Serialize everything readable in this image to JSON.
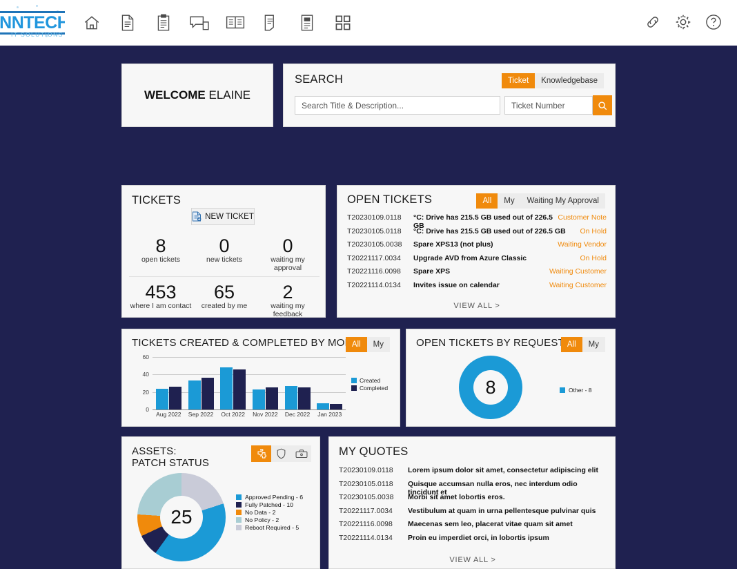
{
  "brand": {
    "logo_main": "ENNTECH",
    "logo_sub": "IT SOLUTIONS",
    "accent_orange": "#f08a0c",
    "accent_blue": "#1b9ad6",
    "navy": "#1f2150"
  },
  "topnav": {
    "items": [
      {
        "icon": "home-icon",
        "name": "home"
      },
      {
        "icon": "document-icon",
        "name": "documents"
      },
      {
        "icon": "clipboard-icon",
        "name": "tickets"
      },
      {
        "icon": "devices-icon",
        "name": "assets"
      },
      {
        "icon": "book-icon",
        "name": "knowledgebase"
      },
      {
        "icon": "pages-icon",
        "name": "quotes"
      },
      {
        "icon": "invoice-icon",
        "name": "invoices"
      },
      {
        "icon": "grid-icon",
        "name": "apps"
      }
    ],
    "right_items": [
      {
        "icon": "link-icon",
        "name": "links"
      },
      {
        "icon": "gear-icon",
        "name": "settings"
      },
      {
        "icon": "help-icon",
        "name": "help"
      }
    ]
  },
  "welcome": {
    "prefix": "WELCOME",
    "name": "ELAINE"
  },
  "search": {
    "title": "SEARCH",
    "tabs": [
      {
        "label": "Ticket",
        "active": true
      },
      {
        "label": "Knowledgebase",
        "active": false
      }
    ],
    "title_placeholder": "Search Title & Description...",
    "title_value": "",
    "number_placeholder": "Ticket Number",
    "number_value": "",
    "search_icon": "search-icon"
  },
  "tickets": {
    "title": "TICKETS",
    "new_ticket_label": "NEW TICKET",
    "new_ticket_icon": "new-document-icon",
    "stats_top": [
      {
        "num": "8",
        "label": "open tickets"
      },
      {
        "num": "0",
        "label": "new tickets"
      },
      {
        "num": "0",
        "label": "waiting my approval"
      }
    ],
    "stats_bottom": [
      {
        "num": "453",
        "label": "where I am contact"
      },
      {
        "num": "65",
        "label": "created by me"
      },
      {
        "num": "2",
        "label": "waiting my feedback"
      }
    ]
  },
  "open_tickets": {
    "title": "OPEN TICKETS",
    "tabs": [
      {
        "label": "All",
        "active": true
      },
      {
        "label": "My",
        "active": false
      },
      {
        "label": "Waiting My Approval",
        "active": false
      }
    ],
    "rows": [
      {
        "id": "T20230109.0118",
        "subject": "°C: Drive has 215.5 GB used out of 226.5 GB",
        "status": "Customer Note"
      },
      {
        "id": "T20230105.0118",
        "subject": "°C: Drive has 215.5 GB used out of 226.5 GB",
        "status": "On Hold"
      },
      {
        "id": "T20230105.0038",
        "subject": "Spare XPS13 (not plus)",
        "status": "Waiting Vendor"
      },
      {
        "id": "T20221117.0034",
        "subject": "Upgrade AVD from Azure Classic",
        "status": "On Hold"
      },
      {
        "id": "T20221116.0098",
        "subject": "Spare XPS",
        "status": "Waiting Customer"
      },
      {
        "id": "T20221114.0134",
        "subject": "Invites issue on calendar",
        "status": "Waiting Customer"
      }
    ],
    "view_all": "VIEW ALL >"
  },
  "quotes": {
    "title": "MY QUOTES",
    "rows": [
      {
        "id": "T20230109.0118",
        "text": "Lorem ipsum dolor sit amet, consectetur adipiscing elit"
      },
      {
        "id": "T20230105.0118",
        "text": "Quisque accumsan nulla eros, nec interdum odio tincidunt et"
      },
      {
        "id": "T20230105.0038",
        "text": "Morbi sit amet lobortis eros."
      },
      {
        "id": "T20221117.0034",
        "text": "Vestibulum at quam in urna pellentesque pulvinar quis"
      },
      {
        "id": "T20221116.0098",
        "text": "Maecenas sem leo, placerat vitae quam sit amet"
      },
      {
        "id": "T20221114.0134",
        "text": "Proin eu imperdiet orci, in lobortis ipsum"
      }
    ],
    "view_all": "VIEW ALL >"
  },
  "assets": {
    "title_line1": "ASSETS:",
    "title_line2": "PATCH STATUS",
    "view_icons": [
      {
        "icon": "puzzle-icon",
        "name": "patch-status",
        "active": true
      },
      {
        "icon": "shield-icon",
        "name": "antivirus-status",
        "active": false
      },
      {
        "icon": "toolbox-icon",
        "name": "hardware-status",
        "active": false
      }
    ]
  },
  "chart_data": [
    {
      "type": "bar",
      "title": "TICKETS CREATED & COMPLETED BY MONTH",
      "tabs": [
        {
          "label": "All",
          "active": true
        },
        {
          "label": "My",
          "active": false
        }
      ],
      "categories": [
        "Aug 2022",
        "Sep 2022",
        "Oct 2022",
        "Nov 2022",
        "Dec 2022",
        "Jan 2023"
      ],
      "series": [
        {
          "name": "Created",
          "color": "#1b9ad6",
          "values": [
            24,
            33,
            48,
            23,
            27,
            7
          ]
        },
        {
          "name": "Completed",
          "color": "#1f2150",
          "values": [
            26,
            36,
            46,
            25,
            25,
            6
          ]
        }
      ],
      "xlabel": "",
      "ylabel": "",
      "ylim": [
        0,
        60
      ],
      "yticks": [
        0,
        20,
        40,
        60
      ],
      "grid": true,
      "legend_position": "right"
    },
    {
      "type": "pie",
      "title": "OPEN TICKETS BY REQUEST TYPE",
      "tabs": [
        {
          "label": "All",
          "active": true
        },
        {
          "label": "My",
          "active": false
        }
      ],
      "center_value": "8",
      "categories": [
        "Other"
      ],
      "values": [
        8
      ],
      "colors": [
        "#1b9ad6"
      ],
      "legend": [
        "Other - 8"
      ],
      "legend_position": "right"
    },
    {
      "type": "pie",
      "title": "ASSETS: PATCH STATUS",
      "center_value": "25",
      "categories": [
        "Reboot Required",
        "Approved Pending",
        "Fully Patched",
        "No Data",
        "No Policy"
      ],
      "values": [
        5,
        10,
        2,
        2,
        6
      ],
      "colors": [
        "#c9cbd8",
        "#1b9ad6",
        "#1f2150",
        "#f08a0c",
        "#a8cdd3"
      ],
      "legend": [
        {
          "label": "Approved Pending - 6",
          "color": "#1b9ad6"
        },
        {
          "label": "Fully Patched - 10",
          "color": "#1f2150"
        },
        {
          "label": "No Data - 2",
          "color": "#f08a0c"
        },
        {
          "label": "No Policy - 2",
          "color": "#a8cdd3"
        },
        {
          "label": "Reboot Required - 5",
          "color": "#c9cbd8"
        }
      ],
      "legend_position": "right"
    }
  ]
}
